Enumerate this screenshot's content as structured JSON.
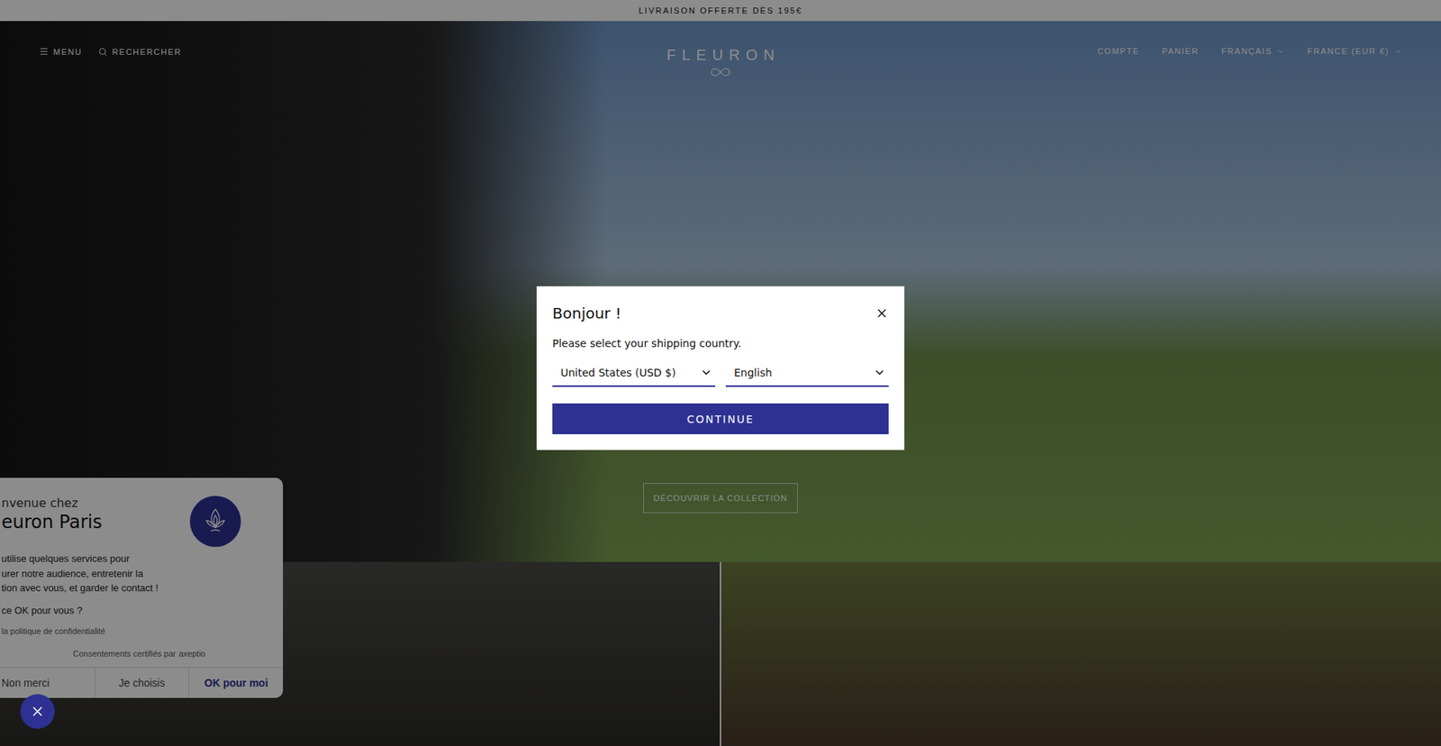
{
  "announcement": "LIVRAISON OFFERTE DÈS 195€",
  "header": {
    "nav_left": [
      {
        "label": "MENU",
        "icon": "menu"
      },
      {
        "label": "RECHERCHER",
        "icon": "search"
      }
    ],
    "logo": "FLEURON",
    "nav_right": [
      {
        "label": "COMPTE",
        "has_dropdown": false
      },
      {
        "label": "PANIER",
        "has_dropdown": false
      },
      {
        "label": "FRANÇAIS",
        "has_dropdown": true
      },
      {
        "label": "FRANCE (EUR €)",
        "has_dropdown": true
      }
    ]
  },
  "hero": {
    "button": "DÉCOUVRIR LA COLLECTION"
  },
  "modal": {
    "title": "Bonjour !",
    "message": "Please select your shipping country.",
    "country": "United States (USD $)",
    "language": "English",
    "button": "CONTINUE"
  },
  "cookie_banner": {
    "welcome": "nvenue chez",
    "brand": "euron Paris",
    "lines": [
      "utilise quelques services pour",
      "urer notre audience, entretenir la",
      "tion avec vous, et garder le contact !"
    ],
    "question": "ce OK pour vous ?",
    "policy_link": "la politique de confidentialité",
    "certified": "Consentements certifiés par",
    "certifier": "axeptio",
    "buttons": [
      {
        "label": "Non merci",
        "primary": false
      },
      {
        "label": "Je choisis",
        "primary": false
      },
      {
        "label": "OK pour moi",
        "primary": true
      }
    ]
  }
}
